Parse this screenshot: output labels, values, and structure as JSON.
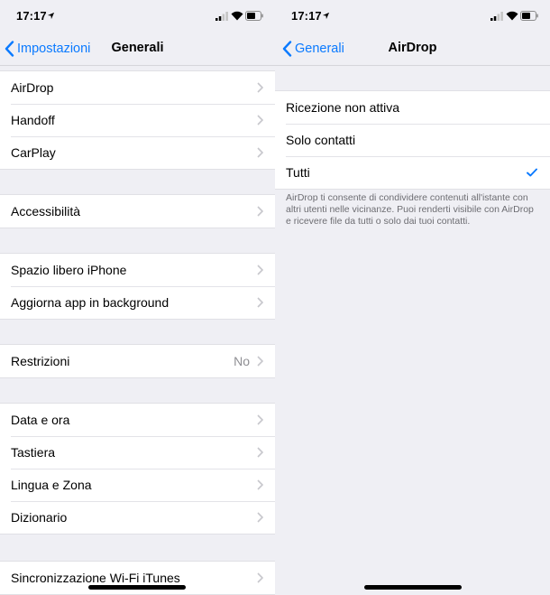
{
  "status": {
    "time": "17:17"
  },
  "left": {
    "nav": {
      "back_label": "Impostazioni",
      "title": "Generali"
    },
    "group1": [
      "AirDrop",
      "Handoff",
      "CarPlay"
    ],
    "group2": [
      "Accessibilità"
    ],
    "group3": [
      "Spazio libero iPhone",
      "Aggiorna app in background"
    ],
    "group4": {
      "label": "Restrizioni",
      "value": "No"
    },
    "group5": [
      "Data e ora",
      "Tastiera",
      "Lingua e Zona",
      "Dizionario"
    ],
    "group6": [
      "Sincronizzazione Wi-Fi iTunes"
    ]
  },
  "right": {
    "nav": {
      "back_label": "Generali",
      "title": "AirDrop"
    },
    "options": [
      "Ricezione non attiva",
      "Solo contatti",
      "Tutti"
    ],
    "selected_index": 2,
    "footer": "AirDrop ti consente di condividere contenuti all'istante con altri utenti nelle vicinanze. Puoi renderti visibile con AirDrop e ricevere file da tutti o solo dai tuoi contatti."
  },
  "colors": {
    "accent": "#0a7aff",
    "background": "#efeff4",
    "secondary_text": "#8e8e93"
  },
  "icons": {
    "location": "location-arrow-icon",
    "signal": "cellular-signal-icon",
    "wifi": "wifi-icon",
    "battery": "battery-icon",
    "back": "chevron-left-icon",
    "disclosure": "chevron-right-icon",
    "check": "checkmark-icon"
  }
}
